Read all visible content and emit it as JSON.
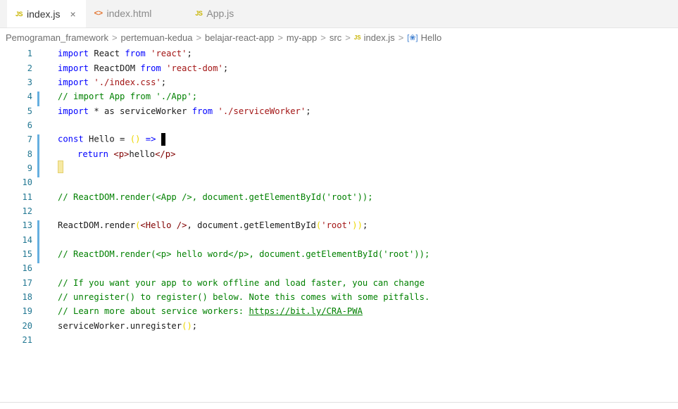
{
  "tabs": [
    {
      "icon": "JS",
      "label": "index.js",
      "close": "×"
    },
    {
      "icon": "<>",
      "label": "index.html"
    },
    {
      "icon": "JS",
      "label": "App.js"
    }
  ],
  "breadcrumb": {
    "parts": [
      "Pemograman_framework",
      "pertemuan-kedua",
      "belajar-react-app",
      "my-app",
      "src"
    ],
    "file_icon": "JS",
    "file": "index.js",
    "symbol_icon": "[❀]",
    "symbol": "Hello",
    "separator": ">"
  },
  "lines": {
    "n": [
      "1",
      "2",
      "3",
      "4",
      "5",
      "6",
      "7",
      "8",
      "9",
      "10",
      "11",
      "12",
      "13",
      "14",
      "15",
      "16",
      "17",
      "18",
      "19",
      "20",
      "21"
    ],
    "l1": {
      "a": "import",
      "b": " React ",
      "c": "from",
      "d": " 'react'",
      "e": ";"
    },
    "l2": {
      "a": "import",
      "b": " ReactDOM ",
      "c": "from",
      "d": " 'react-dom'",
      "e": ";"
    },
    "l3": {
      "a": "import",
      "d": " './index.css'",
      "e": ";"
    },
    "l4": "// import App from './App';",
    "l5": {
      "a": "import",
      "b": " * as serviceWorker ",
      "c": "from",
      "d": " './serviceWorker'",
      "e": ";"
    },
    "l7": {
      "a": "const",
      "b": " Hello = ",
      "p": "()",
      "c": " =>"
    },
    "l8": {
      "a": "return",
      "b": " ",
      "t1": "<p>",
      "txt": "hello",
      "t2": "</p>"
    },
    "l11": "// ReactDOM.render(<App />, document.getElementById('root'));",
    "l13": {
      "a": "ReactDOM.render",
      "p1": "(",
      "t": "<Hello />",
      "b": ", document.getElementById",
      "p2": "(",
      "s": "'root'",
      "p3": "))",
      "e": ";"
    },
    "l15": "// ReactDOM.render(<p> hello word</p>, document.getElementById('root'));",
    "l17": "// If you want your app to work offline and load faster, you can change",
    "l18": "// unregister() to register() below. Note this comes with some pitfalls.",
    "l19a": "// Learn more about service workers: ",
    "l19b": "https://bit.ly/CRA-PWA",
    "l20": {
      "a": "serviceWorker.unregister",
      "p": "()",
      "e": ";"
    }
  }
}
